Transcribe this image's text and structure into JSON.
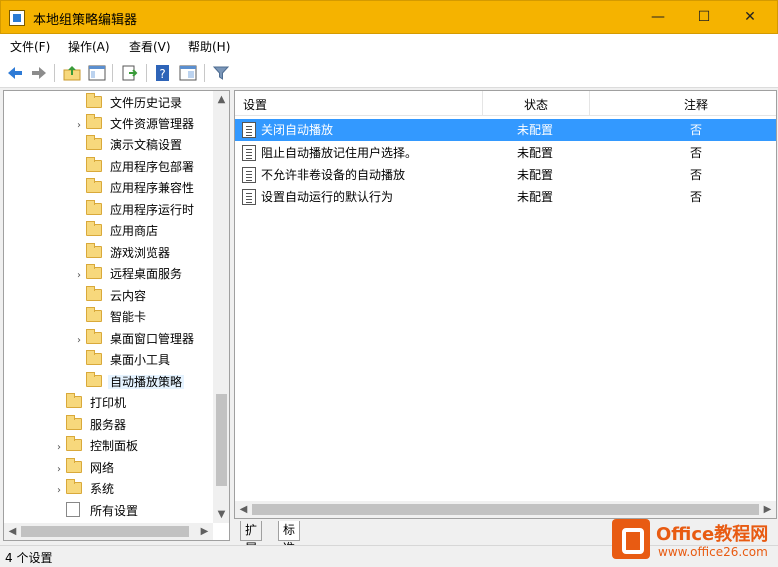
{
  "window": {
    "title": "本地组策略编辑器",
    "minimize": "—",
    "maximize": "☐",
    "close": "✕"
  },
  "menu": [
    "文件(F)",
    "操作(A)",
    "查看(V)",
    "帮助(H)"
  ],
  "tree": {
    "items": [
      {
        "label": "文件历史记录",
        "expandable": false
      },
      {
        "label": "文件资源管理器",
        "expandable": true
      },
      {
        "label": "演示文稿设置",
        "expandable": false
      },
      {
        "label": "应用程序包部署",
        "expandable": false
      },
      {
        "label": "应用程序兼容性",
        "expandable": false
      },
      {
        "label": "应用程序运行时",
        "expandable": false
      },
      {
        "label": "应用商店",
        "expandable": false
      },
      {
        "label": "游戏浏览器",
        "expandable": false
      },
      {
        "label": "远程桌面服务",
        "expandable": true
      },
      {
        "label": "云内容",
        "expandable": false
      },
      {
        "label": "智能卡",
        "expandable": false
      },
      {
        "label": "桌面窗口管理器",
        "expandable": true
      },
      {
        "label": "桌面小工具",
        "expandable": false
      },
      {
        "label": "自动播放策略",
        "expandable": false,
        "selected": true
      },
      {
        "label": "打印机",
        "expandable": false
      },
      {
        "label": "服务器",
        "expandable": false
      },
      {
        "label": "控制面板",
        "expandable": true
      },
      {
        "label": "网络",
        "expandable": true
      },
      {
        "label": "系统",
        "expandable": true
      },
      {
        "label": "所有设置",
        "expandable": false
      }
    ]
  },
  "list": {
    "columns": [
      "设置",
      "状态",
      "注释"
    ],
    "rows": [
      {
        "setting": "关闭自动播放",
        "state": "未配置",
        "comment": "否",
        "selected": true
      },
      {
        "setting": "阻止自动播放记住用户选择。",
        "state": "未配置",
        "comment": "否"
      },
      {
        "setting": "不允许非卷设备的自动播放",
        "state": "未配置",
        "comment": "否"
      },
      {
        "setting": "设置自动运行的默认行为",
        "state": "未配置",
        "comment": "否"
      }
    ]
  },
  "tabs": [
    "扩展",
    "标准"
  ],
  "status": "4 个设置",
  "watermark": {
    "title": "Office教程网",
    "url": "www.office26.com"
  },
  "colors": {
    "titlebar": "#f5b300",
    "selection": "#3399ff",
    "watermark": "#e85b12"
  },
  "icons": {
    "toolbar": [
      "back-arrow-icon",
      "forward-arrow-icon",
      "up-folder-icon",
      "show-hide-tree-icon",
      "export-list-icon",
      "help-icon",
      "properties-icon",
      "filter-icon"
    ]
  }
}
